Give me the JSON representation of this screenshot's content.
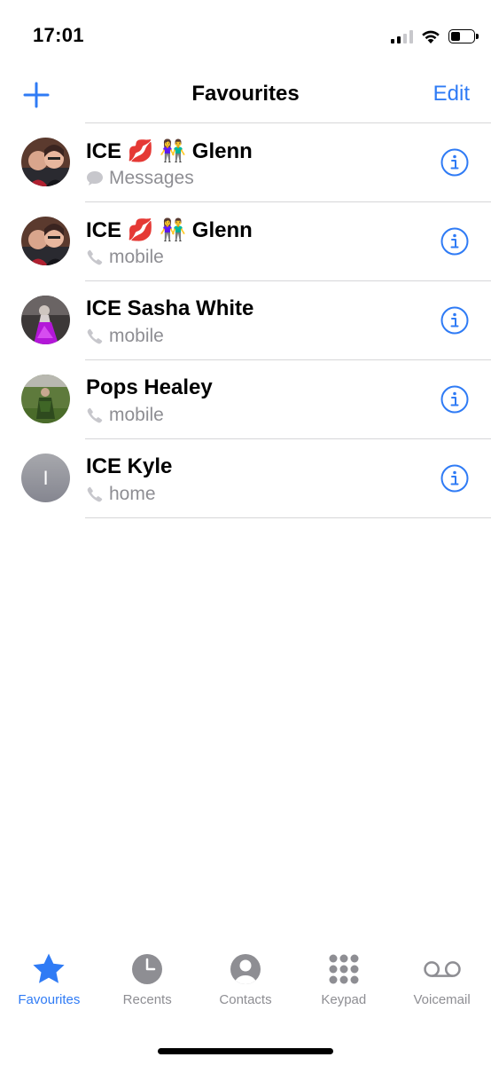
{
  "status": {
    "time": "17:01"
  },
  "nav": {
    "title": "Favourites",
    "edit_label": "Edit",
    "add_icon": "plus-icon"
  },
  "favourites": [
    {
      "name": "ICE 💋 👫 Glenn",
      "sub": "Messages",
      "sub_icon": "message-bubble-icon",
      "avatar": "photo"
    },
    {
      "name": "ICE 💋 👫 Glenn",
      "sub": "mobile",
      "sub_icon": "phone-icon",
      "avatar": "photo"
    },
    {
      "name": "ICE Sasha White",
      "sub": "mobile",
      "sub_icon": "phone-icon",
      "avatar": "photo"
    },
    {
      "name": "Pops Healey",
      "sub": "mobile",
      "sub_icon": "phone-icon",
      "avatar": "photo"
    },
    {
      "name": "ICE Kyle",
      "sub": "home",
      "sub_icon": "phone-icon",
      "avatar": "initial",
      "initial": "I"
    }
  ],
  "tabs": [
    {
      "label": "Favourites",
      "icon": "star-icon",
      "active": true
    },
    {
      "label": "Recents",
      "icon": "clock-icon",
      "active": false
    },
    {
      "label": "Contacts",
      "icon": "person-circle-icon",
      "active": false
    },
    {
      "label": "Keypad",
      "icon": "keypad-icon",
      "active": false
    },
    {
      "label": "Voicemail",
      "icon": "voicemail-icon",
      "active": false
    }
  ],
  "colors": {
    "accent": "#2f7bf5",
    "secondary_text": "#8e8e93",
    "separator": "#d6d6d8"
  }
}
